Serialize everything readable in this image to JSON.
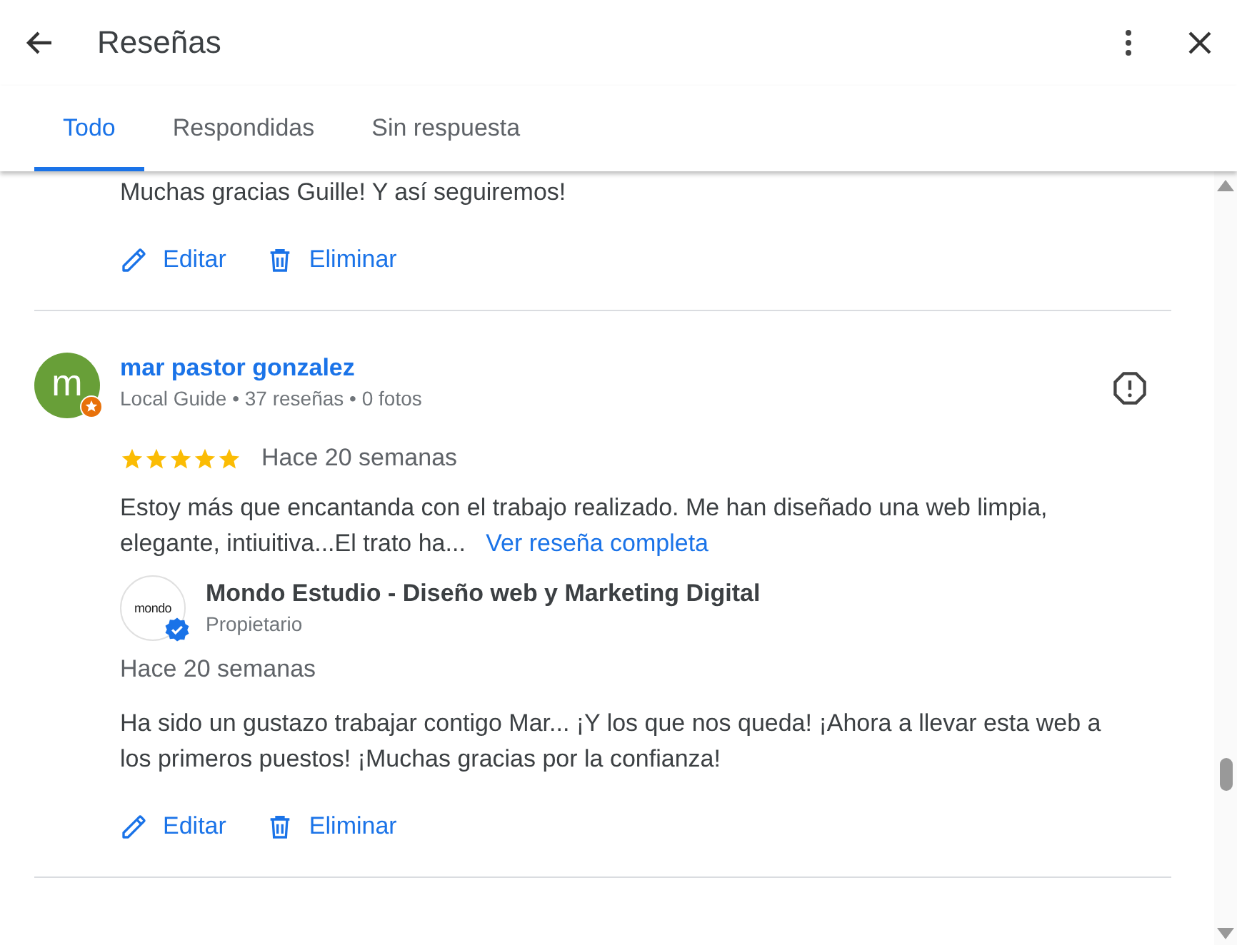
{
  "header": {
    "title": "Reseñas"
  },
  "tabs": [
    {
      "label": "Todo",
      "selected": true
    },
    {
      "label": "Respondidas",
      "selected": false
    },
    {
      "label": "Sin respuesta",
      "selected": false
    }
  ],
  "previous_reply": {
    "text": "Muchas gracias Guille! Y así seguiremos!",
    "actions": [
      "Editar",
      "Eliminar"
    ]
  },
  "review": {
    "avatar_letter": "m",
    "local_guide": true,
    "name": "mar pastor gonzalez",
    "meta": "Local Guide • 37 reseñas • 0 fotos",
    "stars": 5,
    "time": "Hace 20 semanas",
    "text": "Estoy más que encantanda con el trabajo realizado. Me han diseñado una web limpia, elegante, intiuitiva...El trato ha...",
    "more_link": "Ver reseña completa",
    "reply": {
      "logo_text": "mondo",
      "verified": true,
      "owner": "Mondo Estudio - Diseño web y Marketing Digital",
      "role": "Propietario",
      "time": "Hace 20 semanas",
      "text": "Ha sido un gustazo trabajar contigo Mar... ¡Y los que nos queda! ¡Ahora a llevar esta web a los primeros puestos! ¡Muchas gracias por la confianza!",
      "actions": [
        "Editar",
        "Eliminar"
      ]
    }
  }
}
